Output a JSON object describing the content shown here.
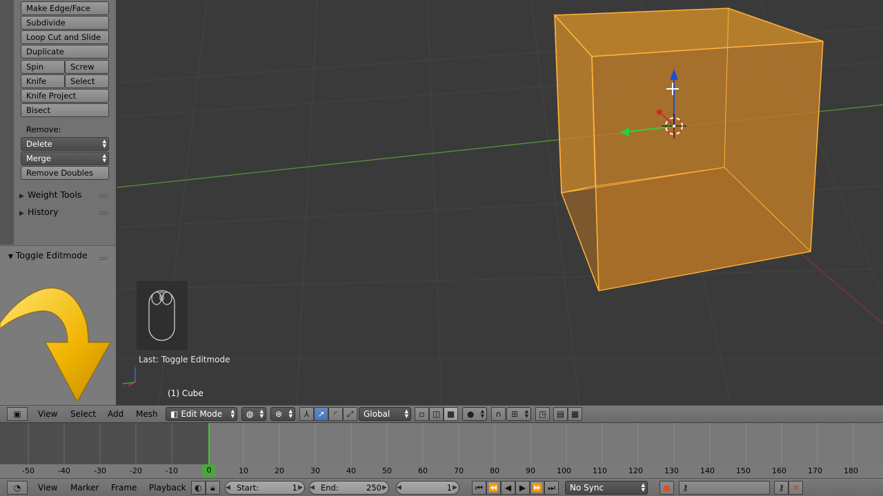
{
  "tools": {
    "buttons": [
      {
        "label": "Make Edge/Face"
      },
      {
        "label": "Subdivide"
      },
      {
        "label": "Loop Cut and Slide"
      },
      {
        "label": "Duplicate"
      },
      {
        "label": "Spin"
      },
      {
        "label": "Screw"
      },
      {
        "label": "Knife"
      },
      {
        "label": "Select"
      },
      {
        "label": "Knife Project"
      },
      {
        "label": "Bisect"
      }
    ],
    "remove_label": "Remove:",
    "delete_label": "Delete",
    "merge_label": "Merge",
    "remove_doubles_label": "Remove Doubles",
    "weight_tools_label": "Weight Tools",
    "history_label": "History"
  },
  "operator_panel": {
    "title": "Toggle Editmode"
  },
  "viewport": {
    "last_operator": "Last: Toggle Editmode",
    "object_name": "(1) Cube"
  },
  "view_header": {
    "menus": [
      "View",
      "Select",
      "Add",
      "Mesh"
    ],
    "mode": "Edit Mode",
    "orientation": "Global"
  },
  "timeline": {
    "ruler_ticks": [
      "-50",
      "-40",
      "-30",
      "-20",
      "-10",
      "0",
      "10",
      "20",
      "30",
      "40",
      "50",
      "60",
      "70",
      "80",
      "90",
      "100",
      "110",
      "120",
      "130",
      "140",
      "150",
      "160",
      "170",
      "180"
    ],
    "current_frame": "0",
    "menus": [
      "View",
      "Marker",
      "Frame",
      "Playback"
    ],
    "start_label": "Start:",
    "start_value": "1",
    "end_label": "End:",
    "end_value": "250",
    "frame_value": "1",
    "sync": "No Sync"
  },
  "colors": {
    "selected_mesh": "#f5a623",
    "x_axis": "#c0392b",
    "y_axis": "#2ecc40",
    "z_axis": "#1f4fd1",
    "active_tool_blue": "#5a84c2"
  }
}
